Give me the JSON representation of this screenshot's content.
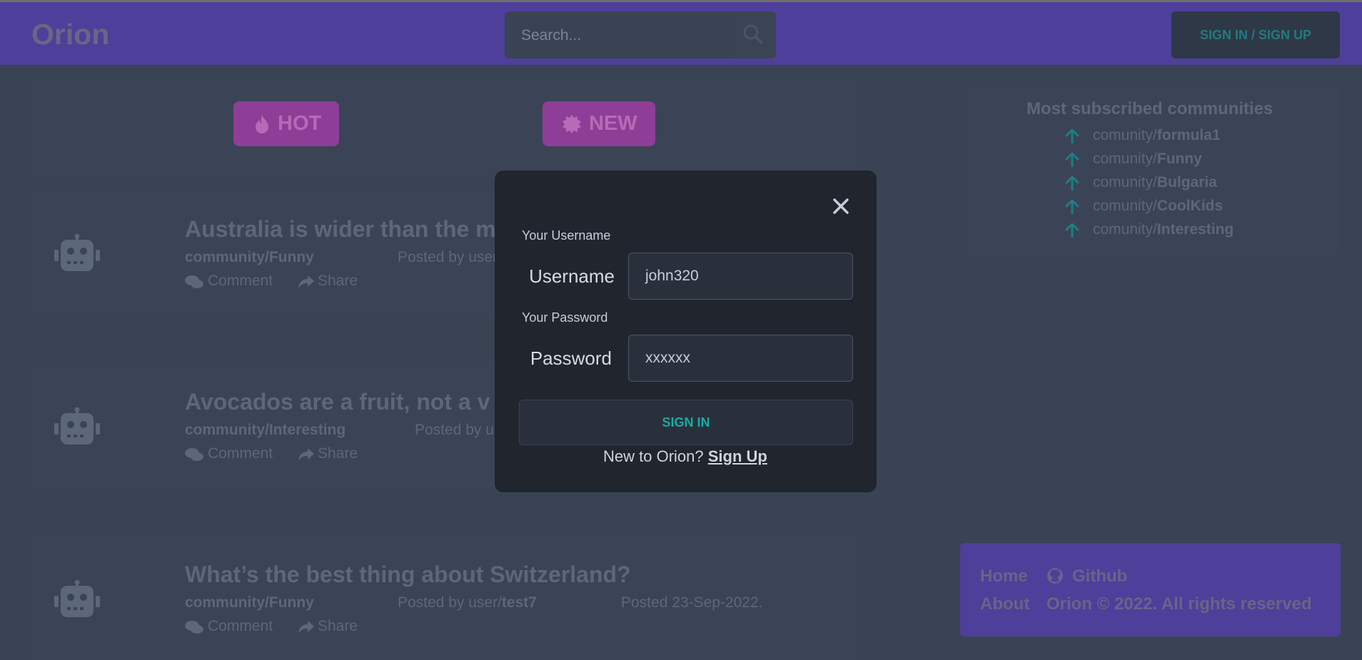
{
  "header": {
    "logo": "Orion",
    "search_placeholder": "Search...",
    "signin_label": "SIGN IN / SIGN UP"
  },
  "sort_tabs": [
    {
      "label": "HOT",
      "icon": "fire-icon"
    },
    {
      "label": "NEW",
      "icon": "sun-badge-icon"
    }
  ],
  "posts": [
    {
      "title": "Australia is wider than the m",
      "community": "community/Funny",
      "posted_by": "Posted by user",
      "user": "",
      "date": ""
    },
    {
      "title": "Avocados are a fruit, not a v",
      "community": "community/Interesting",
      "posted_by": "Posted by u",
      "user": "",
      "date": ""
    },
    {
      "title": "What’s the best thing about Switzerland?",
      "community": "community/Funny",
      "posted_by": "Posted by user/",
      "user": "test7",
      "date": "Posted 23-Sep-2022."
    }
  ],
  "post_actions": {
    "comment": "Comment",
    "share": "Share"
  },
  "sidebar": {
    "title": "Most subscribed communities",
    "prefix": "comunity/",
    "items": [
      "formula1",
      "Funny",
      "Bulgaria",
      "CoolKids",
      "Interesting"
    ]
  },
  "footer": {
    "home": "Home",
    "github": "Github",
    "about": "About",
    "copyright": "Orion © 2022. All rights reserved"
  },
  "modal": {
    "username_label": "Your Username",
    "username_addon": "Username",
    "username_value": "john320",
    "password_label": "Your Password",
    "password_addon": "Password",
    "password_value": "xxxxxx",
    "signin_button": "SIGN IN",
    "new_to": "New to Orion? ",
    "signup_link": "Sign Up"
  },
  "colors": {
    "header": "#4e3f9a",
    "background": "#394353",
    "modal": "#20252e",
    "accent_teal": "#1aaaa6",
    "pill": "#8e3e97"
  }
}
